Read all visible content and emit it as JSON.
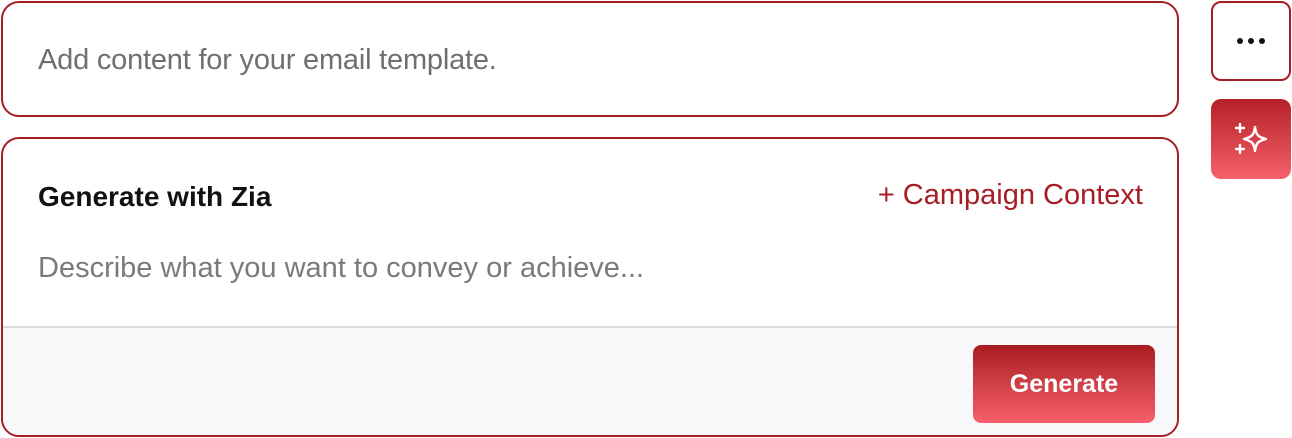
{
  "content_box": {
    "placeholder": "Add content for your email template."
  },
  "zia_panel": {
    "title": "Generate with Zia",
    "campaign_context_label": "+ Campaign Context",
    "prompt_placeholder": "Describe what you want to convey or achieve...",
    "generate_label": "Generate"
  },
  "side_actions": {
    "more_icon": "ellipsis-icon",
    "ai_icon": "sparkle-icon"
  },
  "colors": {
    "accent": "#a61d24",
    "button_gradient_top": "#a81d22",
    "button_gradient_bottom": "#f6606a",
    "footer_bg": "#f7f8fa"
  }
}
